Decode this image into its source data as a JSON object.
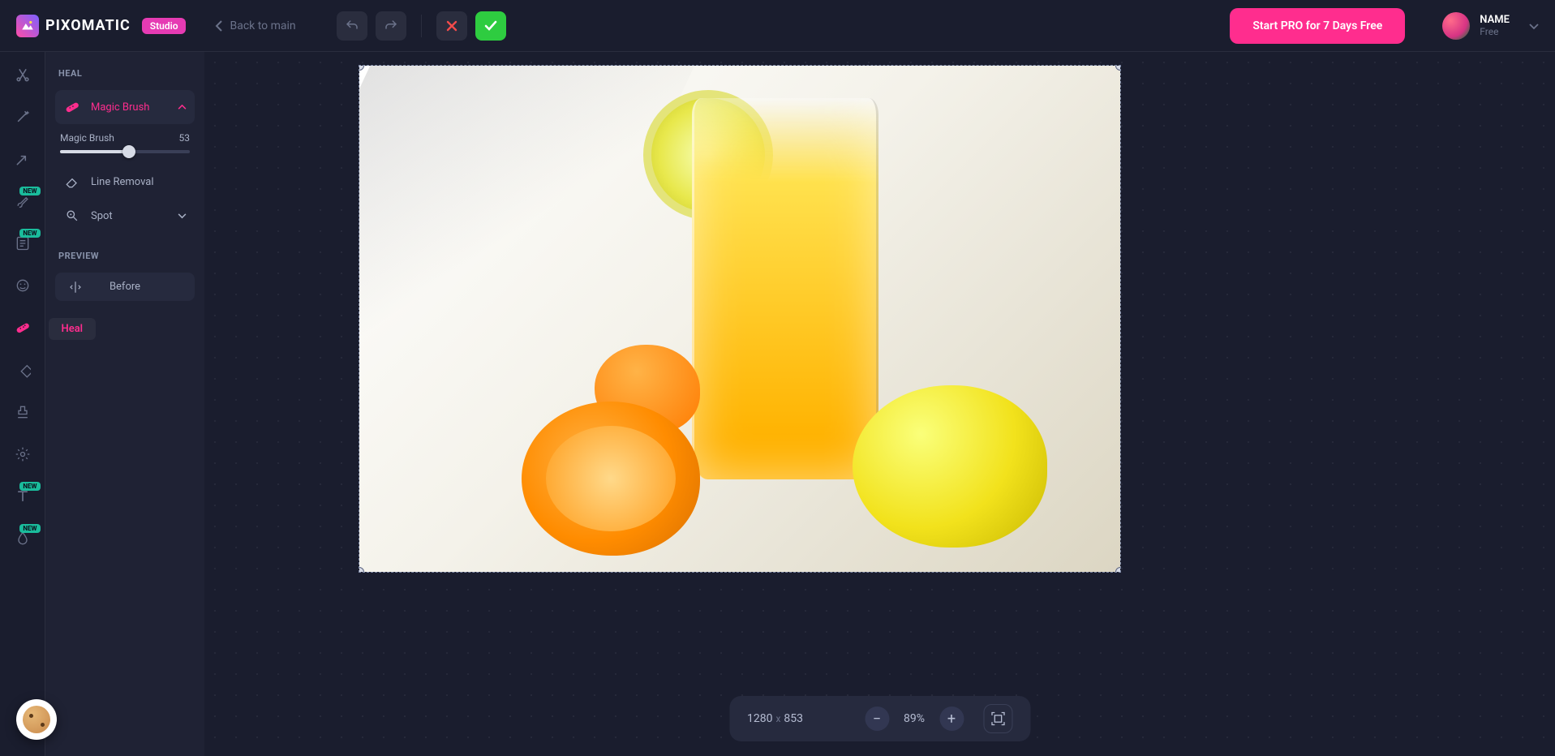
{
  "header": {
    "logo_text": "PIXOMATIC",
    "studio_badge": "Studio",
    "back_label": "Back to main",
    "pro_button": "Start PRO for 7 Days Free",
    "user": {
      "name": "NAME",
      "plan": "Free"
    }
  },
  "tool_rail": {
    "tools": [
      {
        "name": "cut",
        "new": false
      },
      {
        "name": "magic",
        "new": false
      },
      {
        "name": "shape-tool",
        "new": false
      },
      {
        "name": "brush",
        "new": true
      },
      {
        "name": "clipboard",
        "new": true
      },
      {
        "name": "face",
        "new": false
      },
      {
        "name": "heal",
        "new": false,
        "active": true
      },
      {
        "name": "diamond",
        "new": false
      },
      {
        "name": "stamp",
        "new": false
      },
      {
        "name": "gear",
        "new": false
      },
      {
        "name": "text",
        "new": true
      },
      {
        "name": "dropper",
        "new": true
      }
    ],
    "heal_tooltip": "Heal"
  },
  "side_panel": {
    "heading_heal": "HEAL",
    "magic_brush": {
      "label": "Magic Brush",
      "slider_label": "Magic Brush",
      "slider_value": "53",
      "slider_percent": 53
    },
    "line_removal_label": "Line Removal",
    "spot_label": "Spot",
    "heading_preview": "PREVIEW",
    "before_label": "Before"
  },
  "canvas": {
    "image_description": "glass of orange juice with lemon slice, two halved oranges and a whole lemon on sunlit surface",
    "dimensions": {
      "width": "1280",
      "height": "853"
    },
    "zoom": "89%"
  },
  "colors": {
    "accent_pink": "#ff2d8e",
    "accent_green": "#2ecc40",
    "bg_dark": "#1a1d2e",
    "panel": "#1f2234"
  }
}
